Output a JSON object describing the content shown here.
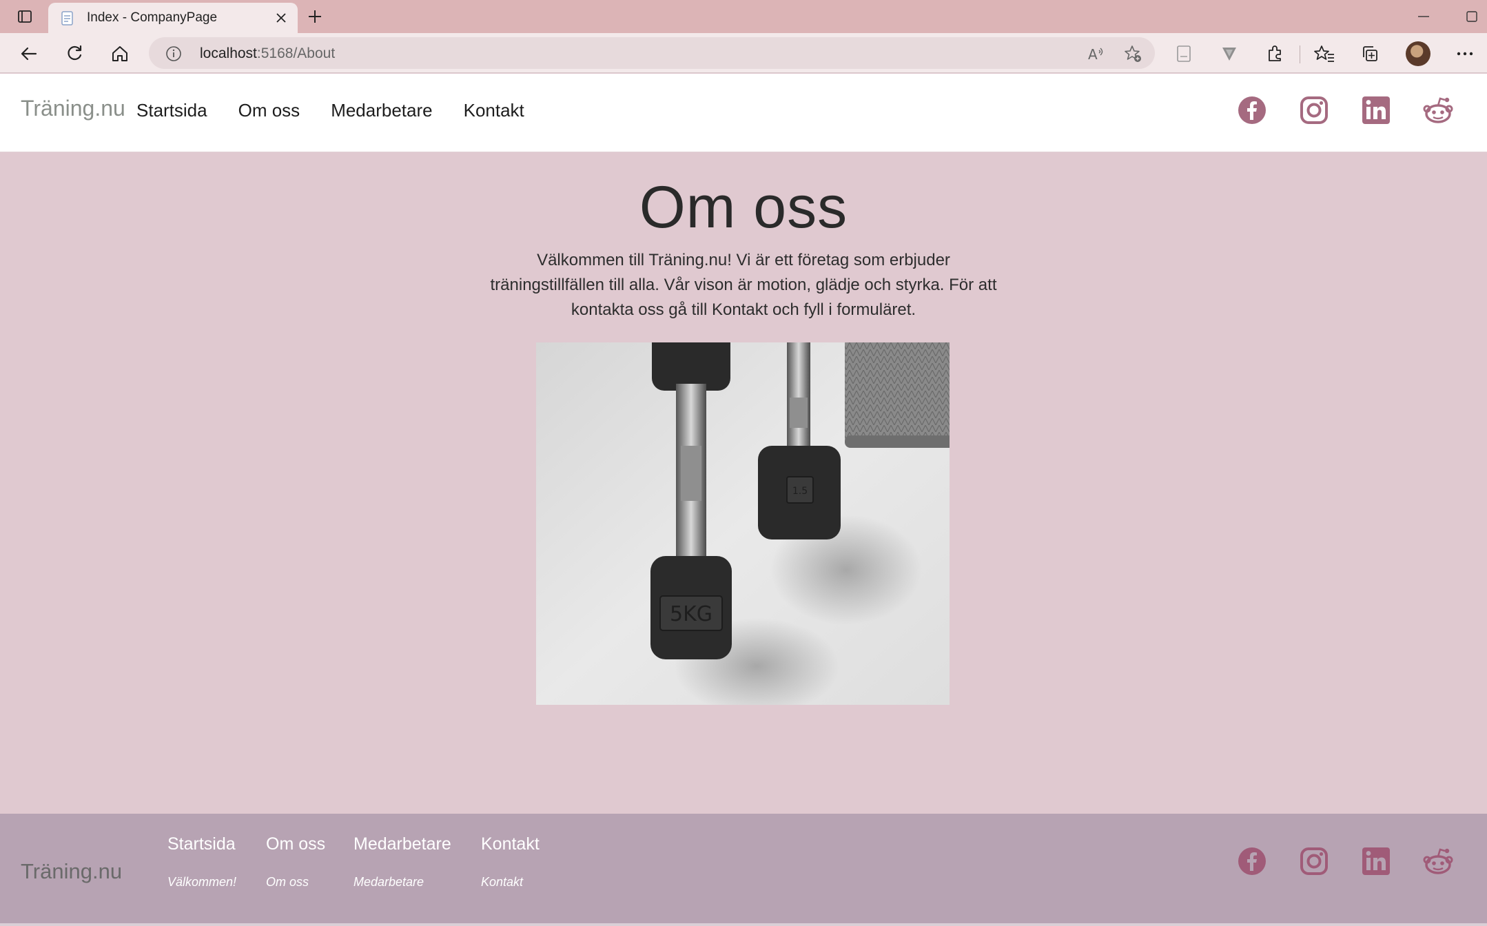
{
  "browser": {
    "tab_title": "Index - CompanyPage",
    "url_host": "localhost",
    "url_rest": ":5168/About"
  },
  "site": {
    "brand": "Träning.nu",
    "nav": [
      "Startsida",
      "Om oss",
      "Medarbetare",
      "Kontakt"
    ],
    "social": [
      "facebook-icon",
      "instagram-icon",
      "linkedin-icon",
      "reddit-icon"
    ],
    "accent_color": "#a56a80"
  },
  "main": {
    "title": "Om oss",
    "intro": "Välkommen till Träning.nu! Vi är ett företag som erbjuder träningstillfällen till alla. Vår vison är motion, glädje och styrka. För att kontakta oss gå till Kontakt och fyll i formuläret.",
    "image_labels": [
      "5KG",
      "1.5"
    ]
  },
  "footer": {
    "brand": "Träning.nu",
    "columns": [
      {
        "heading": "Startsida",
        "link": "Välkommen!"
      },
      {
        "heading": "Om oss",
        "link": "Om oss"
      },
      {
        "heading": "Medarbetare",
        "link": "Medarbetare"
      },
      {
        "heading": "Kontakt",
        "link": "Kontakt"
      }
    ]
  }
}
